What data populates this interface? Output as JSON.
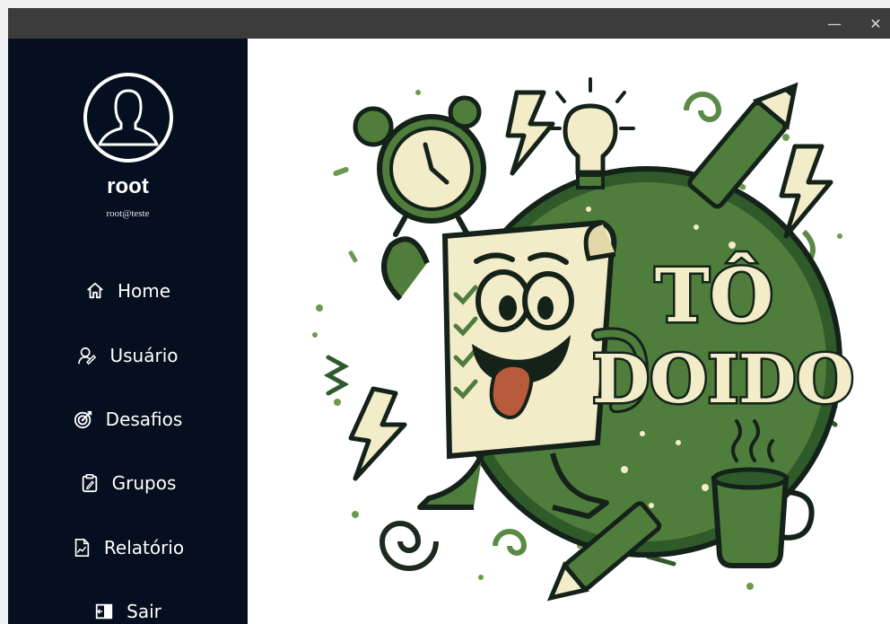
{
  "window": {
    "minimize_glyph": "—",
    "close_glyph": "✕"
  },
  "user": {
    "name": "root",
    "email": "root@teste",
    "avatar_icon": "user-silhouette-icon"
  },
  "nav": {
    "items": [
      {
        "label": "Home",
        "icon": "home-icon"
      },
      {
        "label": "Usuário",
        "icon": "user-edit-icon"
      },
      {
        "label": "Desafios",
        "icon": "target-icon"
      },
      {
        "label": "Grupos",
        "icon": "clipboard-icon"
      },
      {
        "label": "Relatório",
        "icon": "report-icon"
      },
      {
        "label": "Sair",
        "icon": "logout-icon"
      }
    ]
  },
  "illustration": {
    "text_line1": "TÔ",
    "text_line2": "DOIDO"
  },
  "colors": {
    "titlebar": "#3c3c3c",
    "sidebar": "#050f1f",
    "green_dark": "#2f5a2a",
    "green_mid": "#5a8a45",
    "cream": "#f3ecc8",
    "outline": "#14221a",
    "tongue": "#b85a3c"
  }
}
